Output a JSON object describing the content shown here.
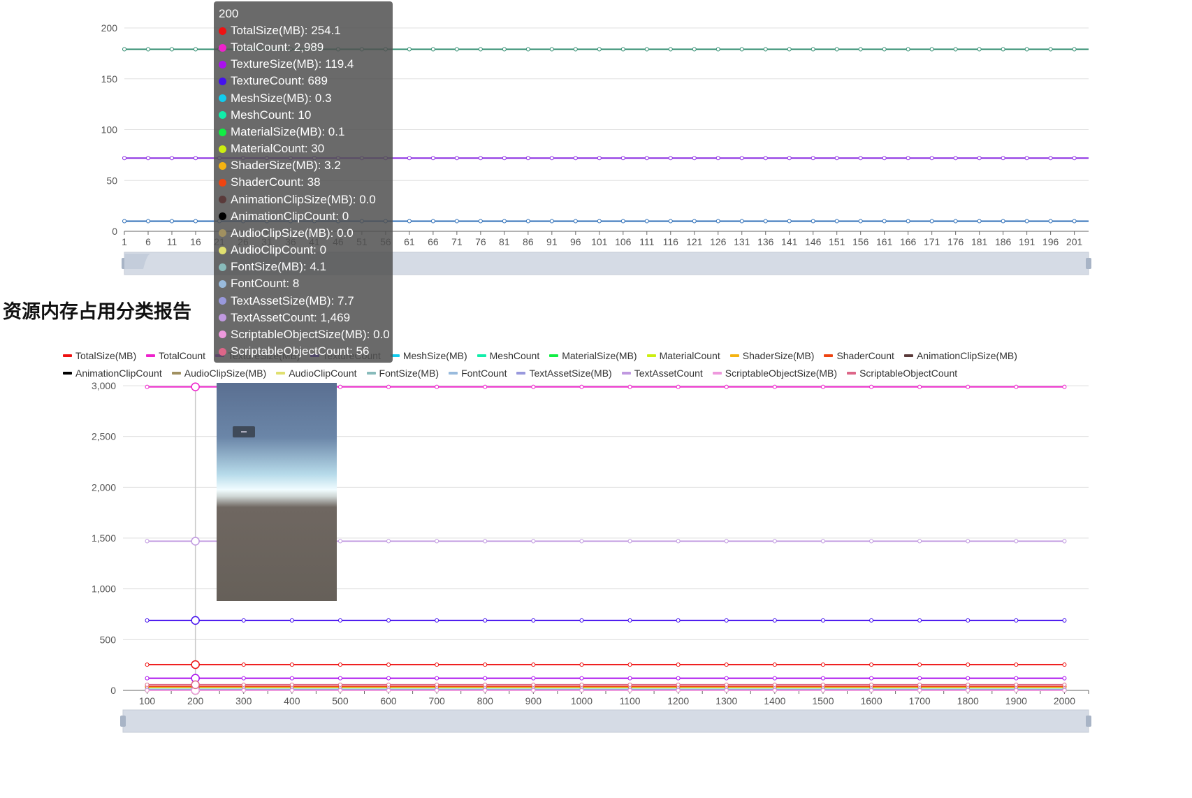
{
  "section_title": "资源内存占用分类报告",
  "chart_data": [
    {
      "type": "line",
      "name": "top",
      "x_ticks": [
        1,
        6,
        11,
        16,
        21,
        26,
        31,
        36,
        41,
        46,
        51,
        56,
        61,
        66,
        71,
        76,
        81,
        86,
        91,
        96,
        101,
        106,
        111,
        116,
        121,
        126,
        131,
        136,
        141,
        146,
        151,
        156,
        161,
        166,
        171,
        176,
        181,
        186,
        191,
        196,
        201
      ],
      "x_range": [
        1,
        204
      ],
      "ylim": [
        0,
        200
      ],
      "y_ticks": [
        0,
        50,
        100,
        150,
        200
      ],
      "grid": true,
      "datazoom": true,
      "series": [
        {
          "color": "#2e8b6e",
          "x": [
            1,
            204
          ],
          "y": [
            179,
            179
          ]
        },
        {
          "color": "#8a2be2",
          "x": [
            1,
            204
          ],
          "y": [
            72,
            72
          ]
        },
        {
          "color": "#2f6fb8",
          "x": [
            1,
            204
          ],
          "y": [
            10,
            10
          ]
        }
      ]
    },
    {
      "type": "line",
      "name": "bottom",
      "x_ticks": [
        100,
        200,
        300,
        400,
        500,
        600,
        700,
        800,
        900,
        1000,
        1100,
        1200,
        1300,
        1400,
        1500,
        1600,
        1700,
        1800,
        1900,
        2000
      ],
      "x_range": [
        50,
        2050
      ],
      "ylim": [
        0,
        3000
      ],
      "y_ticks": [
        0,
        500,
        1000,
        1500,
        2000,
        2500,
        3000
      ],
      "grid": true,
      "legend_position": "top",
      "datazoom": true,
      "highlight_x": 200,
      "series": [
        {
          "name": "TotalSize(MB)",
          "color": "#ee1111",
          "value": 254.1
        },
        {
          "name": "TotalCount",
          "color": "#ee22cc",
          "value": 2989
        },
        {
          "name": "TextureSize(MB)",
          "color": "#aa11ee",
          "value": 119.4
        },
        {
          "name": "TextureCount",
          "color": "#4411ee",
          "value": 689
        },
        {
          "name": "MeshSize(MB)",
          "color": "#11ccee",
          "value": 0.3
        },
        {
          "name": "MeshCount",
          "color": "#11eeaa",
          "value": 10
        },
        {
          "name": "MaterialSize(MB)",
          "color": "#11ee44",
          "value": 0.1
        },
        {
          "name": "MaterialCount",
          "color": "#ccee11",
          "value": 30
        },
        {
          "name": "ShaderSize(MB)",
          "color": "#f5b311",
          "value": 3.2
        },
        {
          "name": "ShaderCount",
          "color": "#ee4411",
          "value": 38
        },
        {
          "name": "AnimationClipSize(MB)",
          "color": "#5a3a3a",
          "value": 0.0
        },
        {
          "name": "AnimationClipCount",
          "color": "#000000",
          "value": 0
        },
        {
          "name": "AudioClipSize(MB)",
          "color": "#a09060",
          "value": 0.0
        },
        {
          "name": "AudioClipCount",
          "color": "#e0e070",
          "value": 0
        },
        {
          "name": "FontSize(MB)",
          "color": "#88bbbb",
          "value": 4.1
        },
        {
          "name": "FontCount",
          "color": "#99bbdd",
          "value": 8
        },
        {
          "name": "TextAssetSize(MB)",
          "color": "#9999dd",
          "value": 7.7
        },
        {
          "name": "TextAssetCount",
          "color": "#c099e0",
          "value": 1469
        },
        {
          "name": "ScriptableObjectSize(MB)",
          "color": "#ee99dd",
          "value": 0.0
        },
        {
          "name": "ScriptableObjectCount",
          "color": "#dd6688",
          "value": 56
        }
      ]
    }
  ],
  "tooltip": {
    "title": "200",
    "rows": [
      {
        "text": "TotalSize(MB): 254.1",
        "color": "#ee1111"
      },
      {
        "text": "TotalCount: 2,989",
        "color": "#ee22cc"
      },
      {
        "text": "TextureSize(MB): 119.4",
        "color": "#aa11ee"
      },
      {
        "text": "TextureCount: 689",
        "color": "#4411ee"
      },
      {
        "text": "MeshSize(MB): 0.3",
        "color": "#11ccee"
      },
      {
        "text": "MeshCount: 10",
        "color": "#11eeaa"
      },
      {
        "text": "MaterialSize(MB): 0.1",
        "color": "#11ee44"
      },
      {
        "text": "MaterialCount: 30",
        "color": "#ccee11"
      },
      {
        "text": "ShaderSize(MB): 3.2",
        "color": "#f5b311"
      },
      {
        "text": "ShaderCount: 38",
        "color": "#ee4411"
      },
      {
        "text": "AnimationClipSize(MB): 0.0",
        "color": "#5a3a3a"
      },
      {
        "text": "AnimationClipCount: 0",
        "color": "#000000"
      },
      {
        "text": "AudioClipSize(MB): 0.0",
        "color": "#a09060"
      },
      {
        "text": "AudioClipCount: 0",
        "color": "#e0e070"
      },
      {
        "text": "FontSize(MB): 4.1",
        "color": "#88bbbb"
      },
      {
        "text": "FontCount: 8",
        "color": "#99bbdd"
      },
      {
        "text": "TextAssetSize(MB): 7.7",
        "color": "#9999dd"
      },
      {
        "text": "TextAssetCount: 1,469",
        "color": "#c099e0"
      },
      {
        "text": "ScriptableObjectSize(MB): 0.0",
        "color": "#ee99dd"
      },
      {
        "text": "ScriptableObjectCount: 56",
        "color": "#dd6688"
      }
    ]
  }
}
